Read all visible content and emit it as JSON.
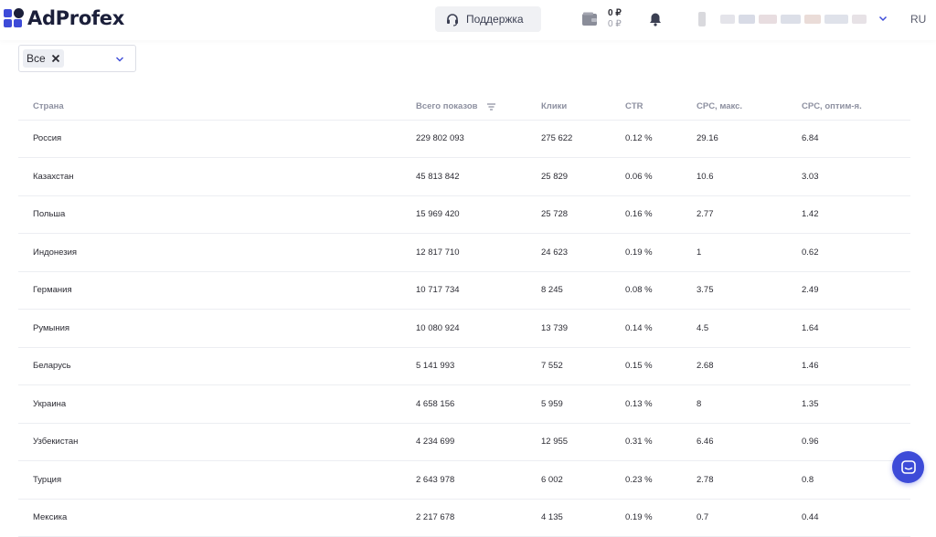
{
  "header": {
    "logo_text": "AdProfex",
    "support_label": "Поддержка",
    "balance_primary": "0 ₽",
    "balance_secondary": "0 ₽",
    "language": "RU",
    "icons": [
      "headset-icon",
      "wallet-icon",
      "bell-icon",
      "chevron-down-icon"
    ]
  },
  "filter": {
    "chip_label": "Все",
    "icons": [
      "close-icon",
      "chevron-down-icon"
    ]
  },
  "table": {
    "columns": [
      "Страна",
      "Всего показов",
      "Клики",
      "CTR",
      "CPC, макс.",
      "CPC, оптим-я."
    ],
    "rows": [
      [
        "Россия",
        "229 802 093",
        "275 622",
        "0.12 %",
        "29.16",
        "6.84"
      ],
      [
        "Казахстан",
        "45 813 842",
        "25 829",
        "0.06 %",
        "10.6",
        "3.03"
      ],
      [
        "Польша",
        "15 969 420",
        "25 728",
        "0.16 %",
        "2.77",
        "1.42"
      ],
      [
        "Индонезия",
        "12 817 710",
        "24 623",
        "0.19 %",
        "1",
        "0.62"
      ],
      [
        "Германия",
        "10 717 734",
        "8 245",
        "0.08 %",
        "3.75",
        "2.49"
      ],
      [
        "Румыния",
        "10 080 924",
        "13 739",
        "0.14 %",
        "4.5",
        "1.64"
      ],
      [
        "Беларусь",
        "5 141 993",
        "7 552",
        "0.15 %",
        "2.68",
        "1.46"
      ],
      [
        "Украина",
        "4 658 156",
        "5 959",
        "0.13 %",
        "8",
        "1.35"
      ],
      [
        "Узбекистан",
        "4 234 699",
        "12 955",
        "0.31 %",
        "6.46",
        "0.96"
      ],
      [
        "Турция",
        "2 643 978",
        "6 002",
        "0.23 %",
        "2.78",
        "0.8"
      ],
      [
        "Мексика",
        "2 217 678",
        "4 135",
        "0.19 %",
        "0.7",
        "0.44"
      ]
    ]
  },
  "colors": {
    "brand": "#3d4bd8",
    "text": "#2b2b33",
    "muted": "#8d90a0"
  }
}
